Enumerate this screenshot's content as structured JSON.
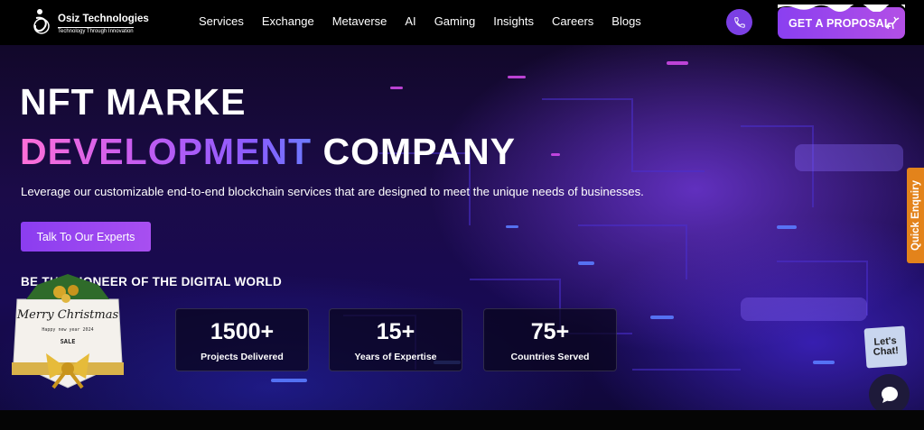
{
  "brand": {
    "name": "Osiz Technologies",
    "tagline": "Technology Through Innovation"
  },
  "nav": {
    "items": [
      "Services",
      "Exchange",
      "Metaverse",
      "AI",
      "Gaming",
      "Insights",
      "Careers",
      "Blogs"
    ],
    "proposal_label": "GET A PROPOSAL",
    "phone_icon": "phone-icon"
  },
  "hero": {
    "line1": "NFT MARKE",
    "line2_highlight": "DEVELOPMENT",
    "line2_rest": "COMPANY",
    "subtitle": "Leverage our customizable end-to-end blockchain services that are designed to meet the unique needs of businesses.",
    "cta_label": "Talk To Our Experts",
    "tagline": "BE THE PIONEER OF THE DIGITAL WORLD",
    "highlight_gradient": [
      "#ff6fd8",
      "#8a5cff"
    ]
  },
  "stats": [
    {
      "value": "1500+",
      "label": "Projects Delivered"
    },
    {
      "value": "15+",
      "label": "Years of Expertise"
    },
    {
      "value": "75+",
      "label": "Countries Served"
    }
  ],
  "badge": {
    "title": "Merry Christmas",
    "sub": "Happy new year 2024",
    "sale": "SALE"
  },
  "side": {
    "quick_enquiry": "Quick Enquiry",
    "lets_chat": "Let's Chat!"
  },
  "colors": {
    "accent": "#8b3df0",
    "enquiry": "#e3831b",
    "chat": "#1e1a3a"
  }
}
